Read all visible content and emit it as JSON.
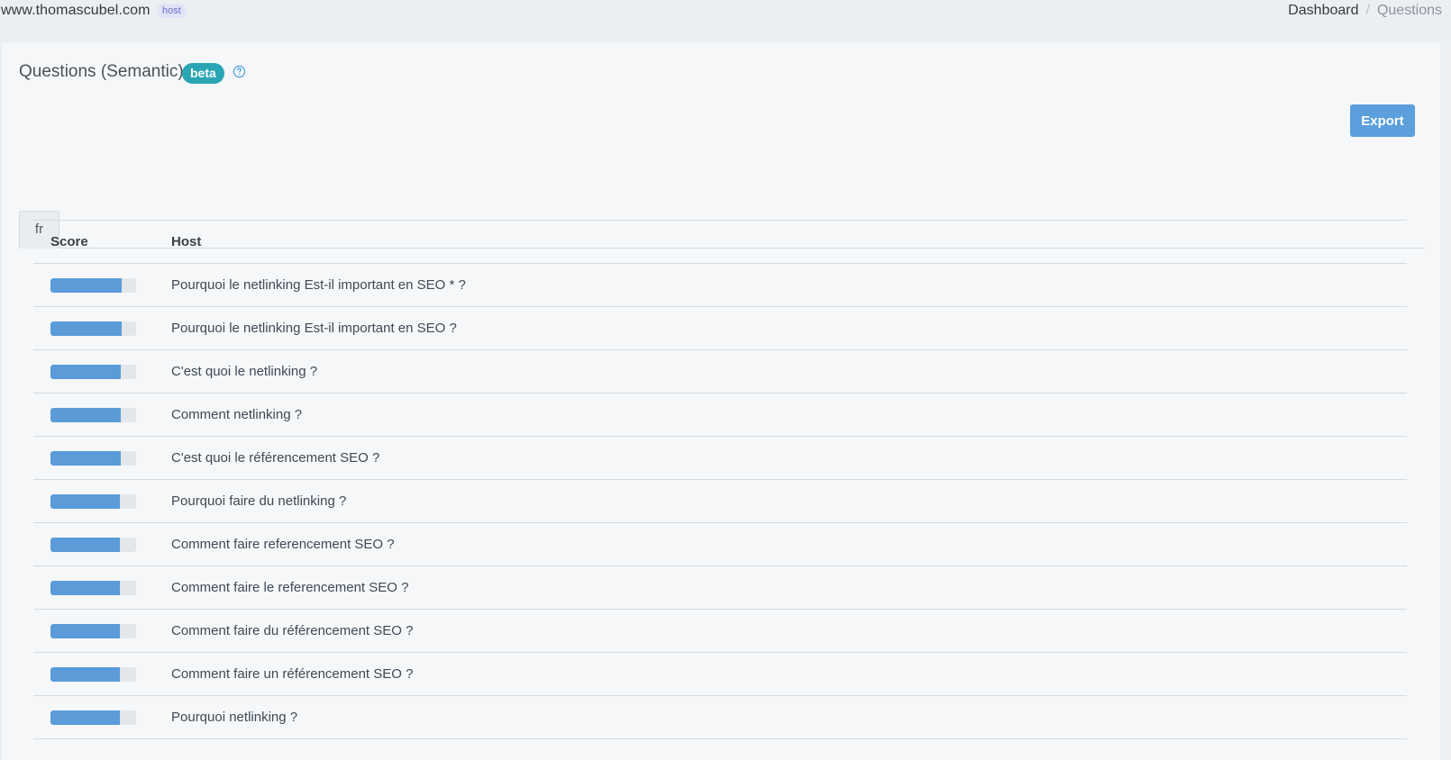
{
  "header": {
    "site": "www.thomascubel.com",
    "badge": "host",
    "breadcrumb": [
      "Dashboard",
      "Questions"
    ]
  },
  "card": {
    "title": "Questions (Semantic)",
    "beta_label": "beta",
    "export_label": "Export",
    "tabs": [
      {
        "label": "fr",
        "active": true
      }
    ]
  },
  "table": {
    "columns": [
      "Score",
      "Host"
    ],
    "rows": [
      {
        "score": 0.83,
        "text": "Pourquoi le netlinking Est-il important en SEO * ?"
      },
      {
        "score": 0.83,
        "text": "Pourquoi le netlinking Est-il important en SEO ?"
      },
      {
        "score": 0.82,
        "text": "C'est quoi le netlinking ?"
      },
      {
        "score": 0.82,
        "text": "Comment netlinking ?"
      },
      {
        "score": 0.82,
        "text": "C'est quoi le référencement SEO ?"
      },
      {
        "score": 0.81,
        "text": "Pourquoi faire du netlinking ?"
      },
      {
        "score": 0.81,
        "text": "Comment faire referencement SEO ?"
      },
      {
        "score": 0.81,
        "text": "Comment faire le referencement SEO ?"
      },
      {
        "score": 0.81,
        "text": "Comment faire du référencement SEO ?"
      },
      {
        "score": 0.81,
        "text": "Comment faire un référencement SEO ?"
      },
      {
        "score": 0.81,
        "text": "Pourquoi netlinking ?"
      }
    ]
  },
  "colors": {
    "accent": "#5b9fdc",
    "beta": "#2aa5b4",
    "score_fill": "#5a9bd8"
  }
}
